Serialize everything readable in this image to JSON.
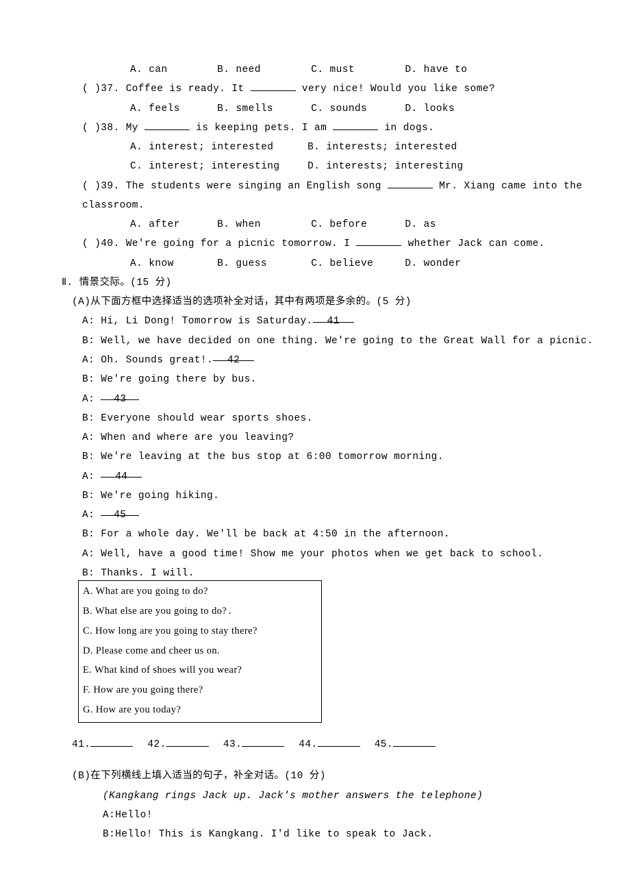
{
  "mcq": {
    "opts36": {
      "a": "A. can",
      "b": "B. need",
      "c": "C. must",
      "d": "D. have to"
    },
    "q37": "(    )37. Coffee is ready. It ",
    "q37b": " very nice! Would you like some?",
    "opts37": {
      "a": "A. feels",
      "b": "B. smells",
      "c": "C. sounds",
      "d": "D. looks"
    },
    "q38": "(    )38. My ",
    "q38m": " is keeping pets. I am ",
    "q38e": " in dogs.",
    "opts38": {
      "a": "A. interest; interested",
      "b": "B. interests; interested",
      "c": "C. interest; interesting",
      "d": "D. interests; interesting"
    },
    "q39": "(    )39. The students were singing an English song ",
    "q39e": " Mr. Xiang came into the classroom.",
    "opts39": {
      "a": "A. after",
      "b": "B. when",
      "c": "C. before",
      "d": "D. as"
    },
    "q40": "(    )40. We're going for a picnic tomorrow. I ",
    "q40e": " whether Jack can come.",
    "opts40": {
      "a": "A. know",
      "b": "B. guess",
      "c": "C. believe",
      "d": "D. wonder"
    }
  },
  "section2": {
    "title": "Ⅱ. 情景交际。(15 分)",
    "partA_intro": "(A)从下面方框中选择适当的选项补全对话，其中有两项是多余的。(5 分)",
    "dlg": {
      "l1a": "A: Hi, Li Dong! Tomorrow is Saturday.",
      "b41": "   41   ",
      "l2": "B: Well, we have decided on one thing. We're going to the Great Wall for a picnic.",
      "l3a": "A: Oh. Sounds great!.",
      "b42": "   42   ",
      "l4": "B: We're going there by bus.",
      "l5a": "A: ",
      "b43": "  43  ",
      "l6": "B: Everyone should wear sports shoes.",
      "l7": "A: When and where are you leaving?",
      "l8": "B: We're leaving at the bus stop at 6:00 tomorrow morning.",
      "l9a": "A: ",
      "b44": "   44  ",
      "l10": "B: We're going hiking.",
      "l11a": "A: ",
      "b45": "  45  ",
      "l12": "B: For a whole day. We'll be back at 4:50 in the afternoon.",
      "l13": "A: Well, have a good time! Show me your photos when we get back to school.",
      "l14": "B: Thanks. I will."
    },
    "box": {
      "A": "A.  What are you going to do?",
      "B": "B.  What else are you going to do?",
      "C": "C.  How long are you going to stay there?",
      "D": "D.  Please come and cheer us on.",
      "E": "E.  What kind of shoes will you wear?",
      "F": "F.  How are you going there?",
      "G": "G.  How are you today?"
    },
    "answers_label": {
      "n41": "41.",
      "n42": "42.",
      "n43": "43.",
      "n44": "44.",
      "n45": "45."
    },
    "partB_intro": "(B)在下列横线上填入适当的句子，补全对话。(10 分)",
    "partB": {
      "stage": "(Kangkang rings Jack up. Jack's mother answers the telephone)",
      "l1": "A:Hello!",
      "l2": "B:Hello! This is Kangkang. I'd like to speak to Jack."
    }
  }
}
